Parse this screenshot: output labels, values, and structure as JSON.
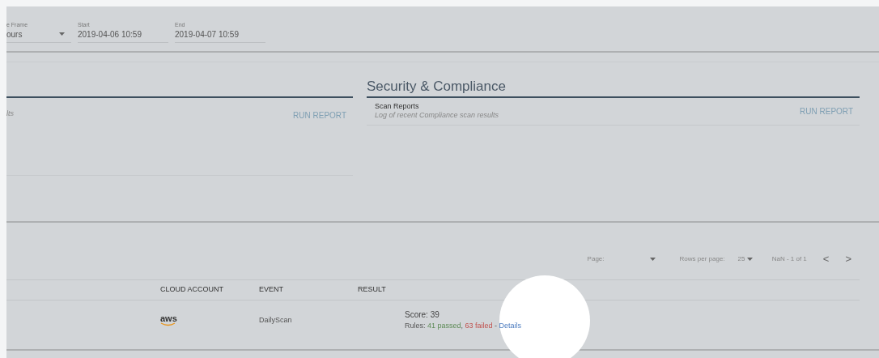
{
  "filters": [
    {
      "label": "e Frame",
      "value": "ours",
      "kind": "select"
    },
    {
      "label": "Start",
      "value": "2019-04-06 10:59",
      "kind": "text"
    },
    {
      "label": "End",
      "value": "2019-04-07 10:59",
      "kind": "text"
    }
  ],
  "report_panels": [
    {
      "reports": [
        {
          "description": "lts",
          "action": "RUN REPORT"
        }
      ]
    },
    {
      "title": "Security & Compliance",
      "reports": [
        {
          "name": "Scan Reports",
          "description": "Log of recent Compliance scan results",
          "action": "RUN REPORT"
        }
      ]
    }
  ],
  "pagination": {
    "page_label": "Page:",
    "rows_label": "Rows per page:",
    "rows_value": "25",
    "range": "NaN - 1 of 1",
    "prev": "<",
    "next": ">"
  },
  "table": {
    "columns": [
      "CLOUD ACCOUNT",
      "EVENT",
      "RESULT"
    ],
    "rows": [
      {
        "cloud_account": "aws",
        "event": "DailyScan",
        "score": "Score: 39",
        "rules_label": "Rules:",
        "passed": "41 passed",
        "comma": ",",
        "failed": "63 failed",
        "separator": "-",
        "details": "Details"
      }
    ]
  }
}
